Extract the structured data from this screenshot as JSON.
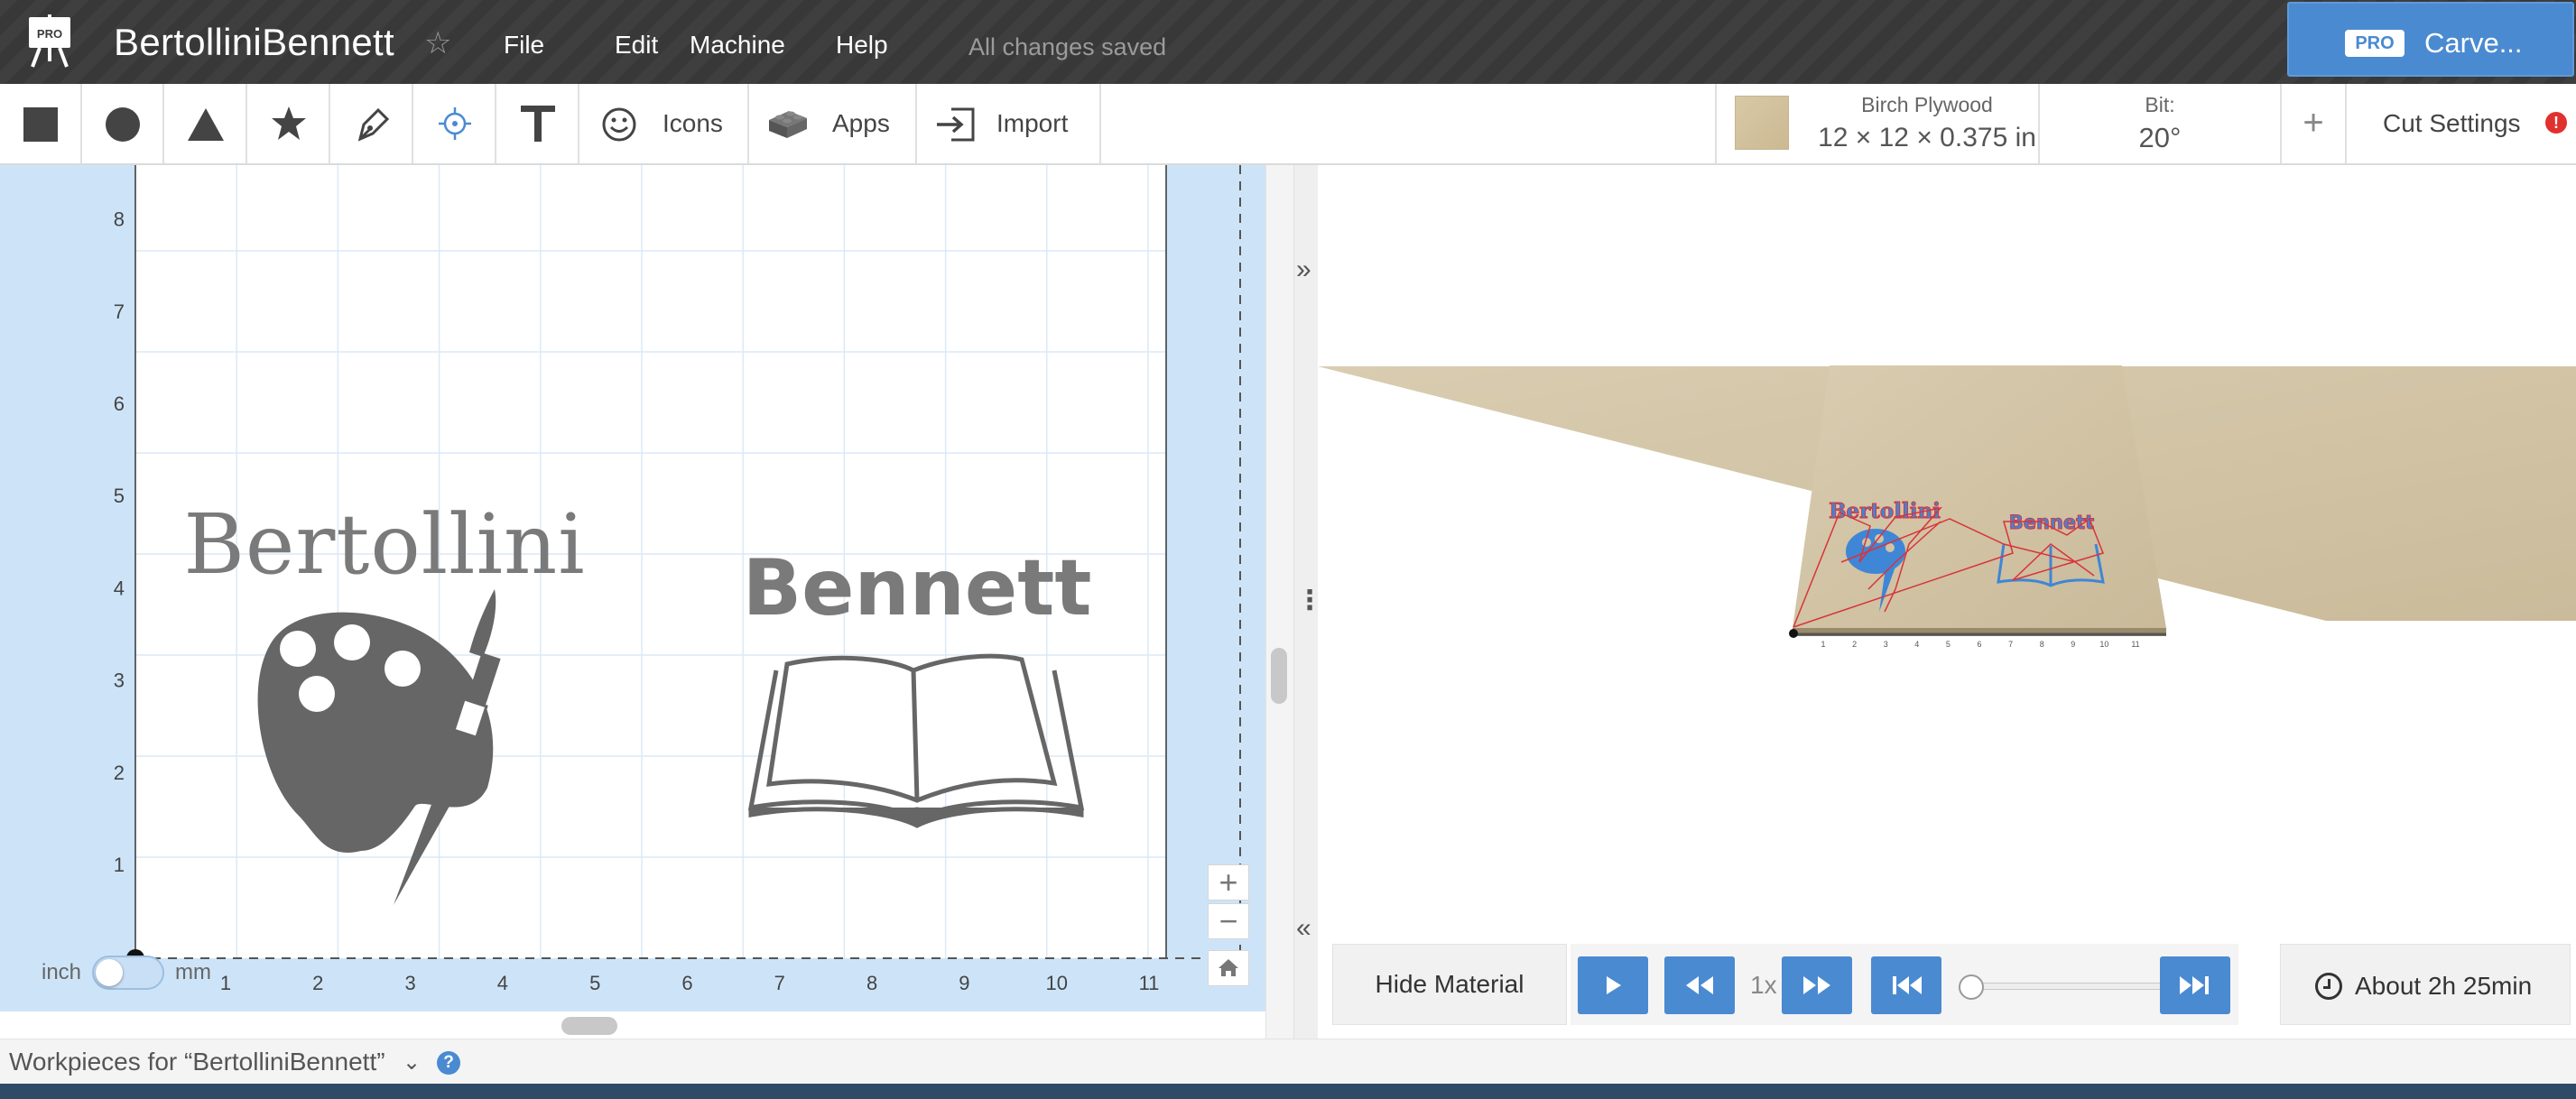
{
  "header": {
    "badge": "PRO",
    "project_title": "BertolliniBennett",
    "menu": [
      "File",
      "Edit",
      "Machine",
      "Help"
    ],
    "status": "All changes saved",
    "carve_badge": "PRO",
    "carve_label": "Carve..."
  },
  "toolbar": {
    "icons_label": "Icons",
    "apps_label": "Apps",
    "import_label": "Import",
    "material_name": "Birch Plywood",
    "material_dims": "12 × 12 × 0.375 in",
    "bit_label": "Bit:",
    "bit_value": "20°",
    "add_symbol": "+",
    "cut_settings_label": "Cut Settings",
    "alert_symbol": "!"
  },
  "canvas": {
    "x_ticks": [
      "1",
      "2",
      "3",
      "4",
      "5",
      "6",
      "7",
      "8",
      "9",
      "10",
      "11"
    ],
    "y_ticks": [
      "1",
      "2",
      "3",
      "4",
      "5",
      "6",
      "7",
      "8"
    ],
    "text_left": "Bertollini",
    "text_right": "Bennett",
    "unit_left": "inch",
    "unit_right": "mm",
    "zoom_in": "+",
    "zoom_out": "−",
    "unit_toggle_state": "inch"
  },
  "preview": {
    "text_left": "Bertollini",
    "text_right": "Bennett",
    "axis_ticks": [
      "1",
      "2",
      "3",
      "4",
      "5",
      "6",
      "7",
      "8",
      "9",
      "10",
      "11"
    ],
    "toolpath_color": "#d9333a",
    "cut_color": "#3f86d6"
  },
  "playback": {
    "hide_material": "Hide Material",
    "speed": "1x",
    "progress": 0,
    "time_estimate": "About 2h 25min"
  },
  "footer": {
    "workpieces": "Workpieces for “BertolliniBennett”",
    "chevron": "≫",
    "help": "?"
  },
  "colors": {
    "accent": "#4a8ad1",
    "topbar": "#3a3a3a",
    "canvas_bg": "#cde4f8",
    "alert": "#e0312e"
  }
}
